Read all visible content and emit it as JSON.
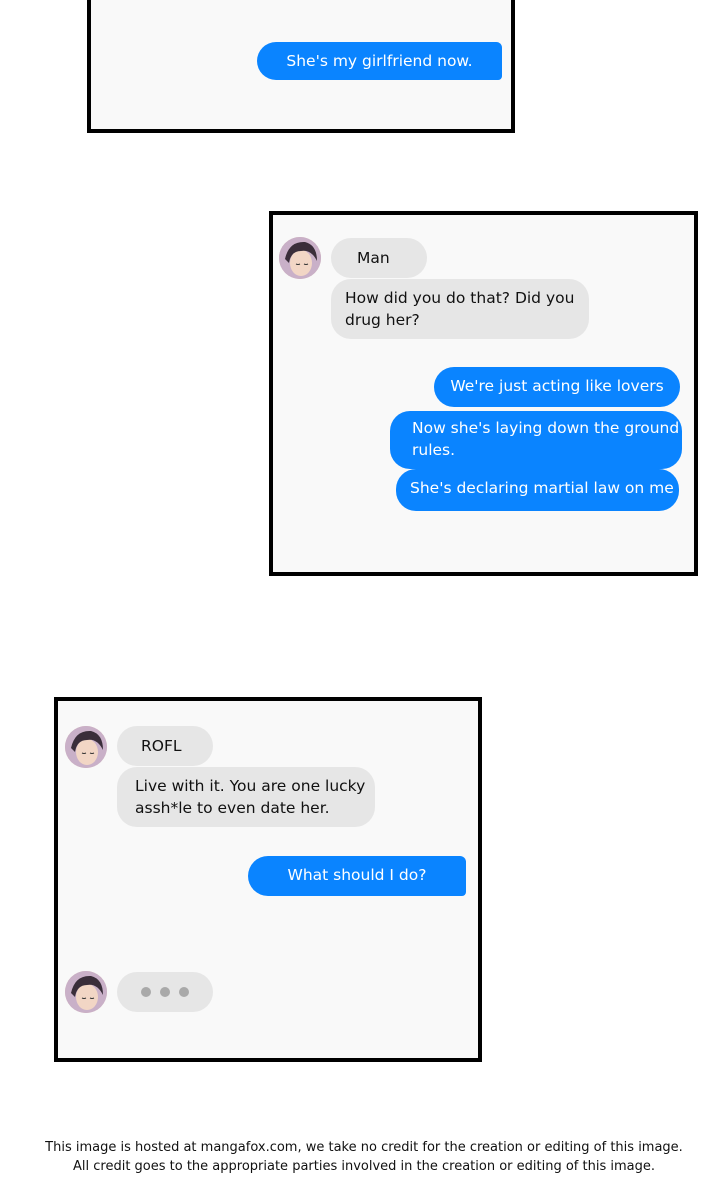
{
  "panel1": {
    "out_messages": [
      "She's my girlfriend now."
    ]
  },
  "panel2": {
    "sender": "Man",
    "in_message": [
      "How did you do that? Did you",
      "drug her?"
    ],
    "out_messages": [
      "We're just acting like lovers",
      [
        "Now she's laying down the ground",
        "rules."
      ],
      "She's declaring martial law on me"
    ]
  },
  "panel3": {
    "sender": "ROFL",
    "in_message": [
      "Live with it. You are one lucky",
      "assh*le to even date her."
    ],
    "out_messages": [
      "What should I do?"
    ],
    "typing_indicator": "typing-dots"
  },
  "footer": {
    "line1": "This image is hosted at mangafox.com, we take no credit for the creation or editing of this image.",
    "line2": "All credit goes to the appropriate parties involved in the creation or editing of this image."
  },
  "colors": {
    "outgoing_bubble": "#0a84ff",
    "incoming_bubble": "#e6e6e6",
    "panel_border": "#000000"
  }
}
